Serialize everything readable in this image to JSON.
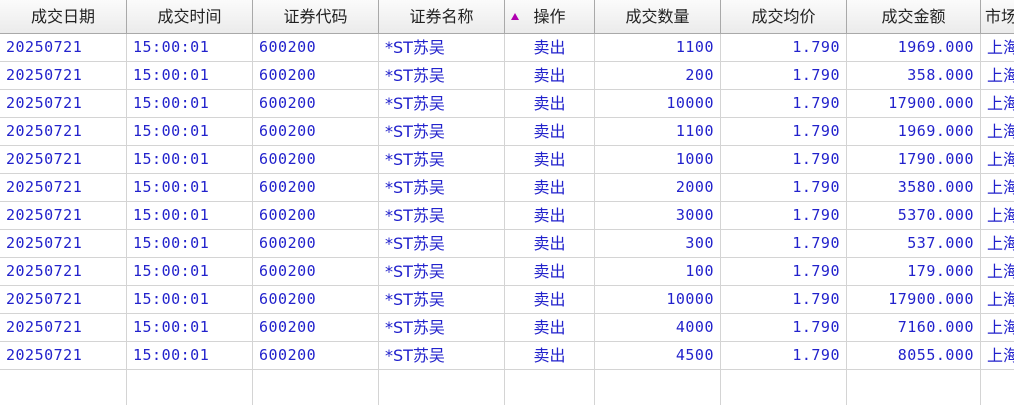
{
  "table": {
    "columns": [
      "成交日期",
      "成交时间",
      "证券代码",
      "证券名称",
      "操作",
      "成交数量",
      "成交均价",
      "成交金额",
      "市场"
    ],
    "rows": [
      [
        "20250721",
        "15:00:01",
        "600200",
        "*ST苏吴",
        "卖出",
        "1100",
        "1.790",
        "1969.000",
        "上海"
      ],
      [
        "20250721",
        "15:00:01",
        "600200",
        "*ST苏吴",
        "卖出",
        "200",
        "1.790",
        "358.000",
        "上海"
      ],
      [
        "20250721",
        "15:00:01",
        "600200",
        "*ST苏吴",
        "卖出",
        "10000",
        "1.790",
        "17900.000",
        "上海"
      ],
      [
        "20250721",
        "15:00:01",
        "600200",
        "*ST苏吴",
        "卖出",
        "1100",
        "1.790",
        "1969.000",
        "上海"
      ],
      [
        "20250721",
        "15:00:01",
        "600200",
        "*ST苏吴",
        "卖出",
        "1000",
        "1.790",
        "1790.000",
        "上海"
      ],
      [
        "20250721",
        "15:00:01",
        "600200",
        "*ST苏吴",
        "卖出",
        "2000",
        "1.790",
        "3580.000",
        "上海"
      ],
      [
        "20250721",
        "15:00:01",
        "600200",
        "*ST苏吴",
        "卖出",
        "3000",
        "1.790",
        "5370.000",
        "上海"
      ],
      [
        "20250721",
        "15:00:01",
        "600200",
        "*ST苏吴",
        "卖出",
        "300",
        "1.790",
        "537.000",
        "上海"
      ],
      [
        "20250721",
        "15:00:01",
        "600200",
        "*ST苏吴",
        "卖出",
        "100",
        "1.790",
        "179.000",
        "上海"
      ],
      [
        "20250721",
        "15:00:01",
        "600200",
        "*ST苏吴",
        "卖出",
        "10000",
        "1.790",
        "17900.000",
        "上海"
      ],
      [
        "20250721",
        "15:00:01",
        "600200",
        "*ST苏吴",
        "卖出",
        "4000",
        "1.790",
        "7160.000",
        "上海"
      ],
      [
        "20250721",
        "15:00:01",
        "600200",
        "*ST苏吴",
        "卖出",
        "4500",
        "1.790",
        "8055.000",
        "上海"
      ]
    ]
  },
  "sort": {
    "icon": "sort-ascending-triangle-icon",
    "color": "#b000b0"
  },
  "colors": {
    "cell_text": "#2222cc",
    "header_bg": "#f0f0f0",
    "grid_line": "#d4d4d4"
  }
}
